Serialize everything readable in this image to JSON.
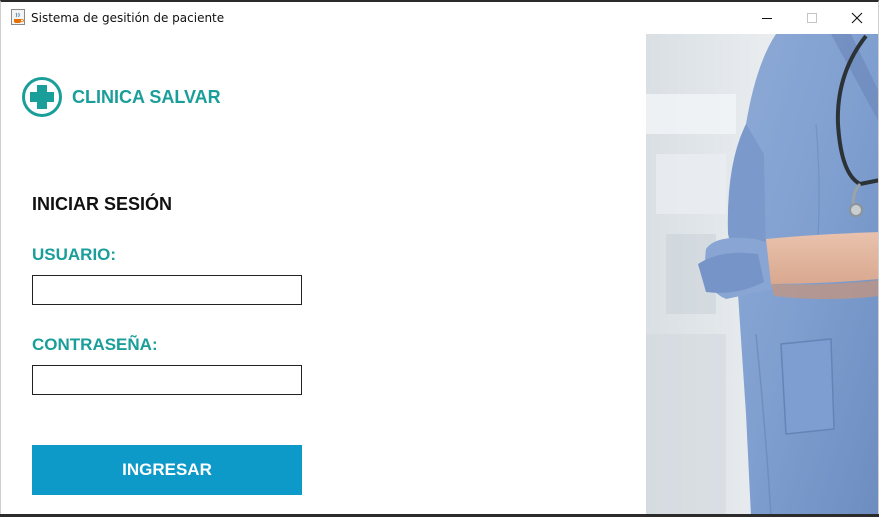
{
  "window": {
    "title": "Sistema de gesitión de paciente",
    "app_icon": "java-cup-icon",
    "controls": [
      "minimize-icon",
      "maximize-icon",
      "close-icon"
    ]
  },
  "brand": {
    "logo_icon": "medical-cross-icon",
    "name": "CLINICA SALVAR",
    "color": "#1a9e9a"
  },
  "login": {
    "title": "INICIAR SESIÓN",
    "username_label": "USUARIO:",
    "username_value": "",
    "password_label": "CONTRASEÑA:",
    "password_value": "",
    "submit_label": "INGRESAR",
    "button_color": "#0e9ac9"
  },
  "image": {
    "subject": "doctor-with-stethoscope-photo"
  }
}
